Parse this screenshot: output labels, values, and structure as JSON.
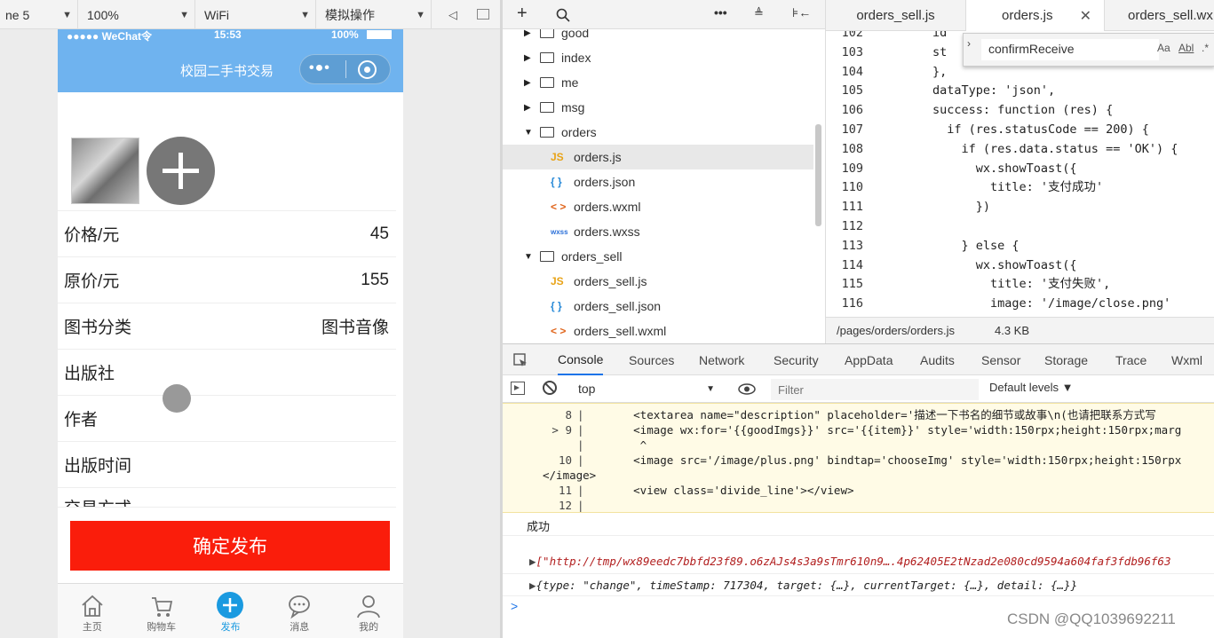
{
  "simulator": {
    "device": "ne 5",
    "zoom": "100%",
    "network": "WiFi",
    "operate": "模拟操作"
  },
  "phone": {
    "status_carrier": "●●●●● WeChat令",
    "status_time": "15:53",
    "status_battery": "100%",
    "nav_title": "校园二手书交易",
    "form": [
      {
        "label": "价格/元",
        "value": "45"
      },
      {
        "label": "原价/元",
        "value": "155"
      },
      {
        "label": "图书分类",
        "value": "图书音像"
      },
      {
        "label": "出版社",
        "value": ""
      },
      {
        "label": "作者",
        "value": ""
      },
      {
        "label": "出版时间",
        "value": ""
      },
      {
        "label": "交易方式",
        "value": ""
      }
    ],
    "submit_label": "确定发布",
    "submit_color": "#fa1d0b",
    "tabs": [
      "主页",
      "购物车",
      "发布",
      "消息",
      "我的"
    ]
  },
  "tree": {
    "items": [
      {
        "label": "good",
        "kind": "folder"
      },
      {
        "label": "index",
        "kind": "folder"
      },
      {
        "label": "me",
        "kind": "folder"
      },
      {
        "label": "msg",
        "kind": "folder"
      },
      {
        "label": "orders",
        "kind": "folder-open"
      },
      {
        "label": "orders.js",
        "kind": "js"
      },
      {
        "label": "orders.json",
        "kind": "json"
      },
      {
        "label": "orders.wxml",
        "kind": "wxml"
      },
      {
        "label": "orders.wxss",
        "kind": "wxss"
      },
      {
        "label": "orders_sell",
        "kind": "folder-open"
      },
      {
        "label": "orders_sell.js",
        "kind": "js"
      },
      {
        "label": "orders_sell.json",
        "kind": "json"
      },
      {
        "label": "orders_sell.wxml",
        "kind": "wxml"
      }
    ],
    "icons": {
      "js": "JS",
      "json": "{ }",
      "wxml": "< >",
      "wxss": "wxss"
    }
  },
  "editor": {
    "tabs": [
      "orders_sell.js",
      "orders.js",
      "orders_sell.wx"
    ],
    "search_value": "confirmReceive",
    "search_opts": [
      "Aa",
      "Abl",
      ".*"
    ],
    "lines": [
      {
        "n": "102",
        "text": "id"
      },
      {
        "n": "103",
        "text": "st"
      },
      {
        "n": "104",
        "text": "},"
      },
      {
        "n": "105",
        "text": "dataType: 'json',"
      },
      {
        "n": "106",
        "text": "success: function (res) {"
      },
      {
        "n": "107",
        "text": "  if (res.statusCode == 200) {"
      },
      {
        "n": "108",
        "text": "    if (res.data.status == 'OK') {"
      },
      {
        "n": "109",
        "text": "      wx.showToast({"
      },
      {
        "n": "110",
        "text": "        title: '支付成功'"
      },
      {
        "n": "111",
        "text": "      })"
      },
      {
        "n": "112",
        "text": ""
      },
      {
        "n": "113",
        "text": "    } else {"
      },
      {
        "n": "114",
        "text": "      wx.showToast({"
      },
      {
        "n": "115",
        "text": "        title: '支付失败',"
      },
      {
        "n": "116",
        "text": "        image: '/image/close.png'"
      }
    ],
    "path": "/pages/orders/orders.js",
    "size": "4.3 KB"
  },
  "devtools": {
    "tabs": [
      "Console",
      "Sources",
      "Network",
      "Security",
      "AppData",
      "Audits",
      "Sensor",
      "Storage",
      "Trace",
      "Wxml"
    ],
    "context": "top",
    "filter_placeholder": "Filter",
    "levels": "Default levels ▼",
    "error_lines": [
      {
        "n": "8",
        "text": "      <textarea name=\"description\" placeholder='描述一下书名的细节或故事\\n(也请把联系方式写"
      },
      {
        "n": "> 9",
        "text": "      <image wx:for='{{goodImgs}}' src='{{item}}' style='width:150rpx;height:150rpx;marg"
      },
      {
        "n": "",
        "text": "       ^"
      },
      {
        "n": "10",
        "text": "      <image src='/image/plus.png' bindtap='chooseImg' style='width:150rpx;height:150rpx"
      },
      {
        "n": "",
        "text": "</image>",
        "out": true
      },
      {
        "n": "11",
        "text": "      <view class='divide_line'></view>"
      },
      {
        "n": "12",
        "text": ""
      }
    ],
    "log_success": "成功",
    "log_array": "[\"http://tmp/wx89eedc7bbfd23f89.o6zAJs4s3a9sTmr610n9….4p62405E2tNzad2e080cd9594a604faf3fdb96f63",
    "log_event": "{type: \"change\", timeStamp: 717304, target: {…}, currentTarget: {…}, detail: {…}}",
    "prompt": ">"
  },
  "watermark": "CSDN @QQ1039692211"
}
